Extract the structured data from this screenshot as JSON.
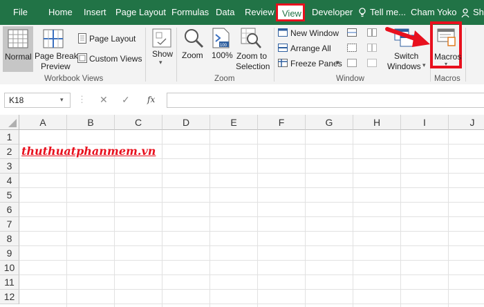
{
  "tabs": [
    "File",
    "Home",
    "Insert",
    "Page Layout",
    "Formulas",
    "Data",
    "Review",
    "View",
    "Developer",
    "Tell me...",
    "Cham Yoko",
    "Sh"
  ],
  "ribbon": {
    "normal": "Normal",
    "page_break_1": "Page Break",
    "page_break_2": "Preview",
    "page_layout": "Page Layout",
    "custom_views": "Custom Views",
    "workbook_views": "Workbook Views",
    "show": "Show",
    "zoom": "Zoom",
    "zoom100": "100%",
    "zoom_to_1": "Zoom to",
    "zoom_to_2": "Selection",
    "zoom_group": "Zoom",
    "new_window": "New Window",
    "arrange_all": "Arrange All",
    "freeze_panes": "Freeze Panes",
    "switch_1": "Switch",
    "switch_2": "Windows",
    "window_group": "Window",
    "macros": "Macros",
    "macros_group": "Macros"
  },
  "formula_bar": {
    "name_box": "K18",
    "fx": "fx",
    "cancel": "✕",
    "enter": "✓",
    "value": ""
  },
  "columns": [
    "A",
    "B",
    "C",
    "D",
    "E",
    "F",
    "G",
    "H",
    "I",
    "J"
  ],
  "rows": [
    "1",
    "2",
    "3",
    "4",
    "5",
    "6",
    "7",
    "8",
    "9",
    "10",
    "11",
    "12"
  ],
  "cell_a2": "thuthuatphanmem.vn",
  "colors": {
    "accent": "#217346",
    "highlight": "#e8101e",
    "link_red": "#e8101e"
  }
}
